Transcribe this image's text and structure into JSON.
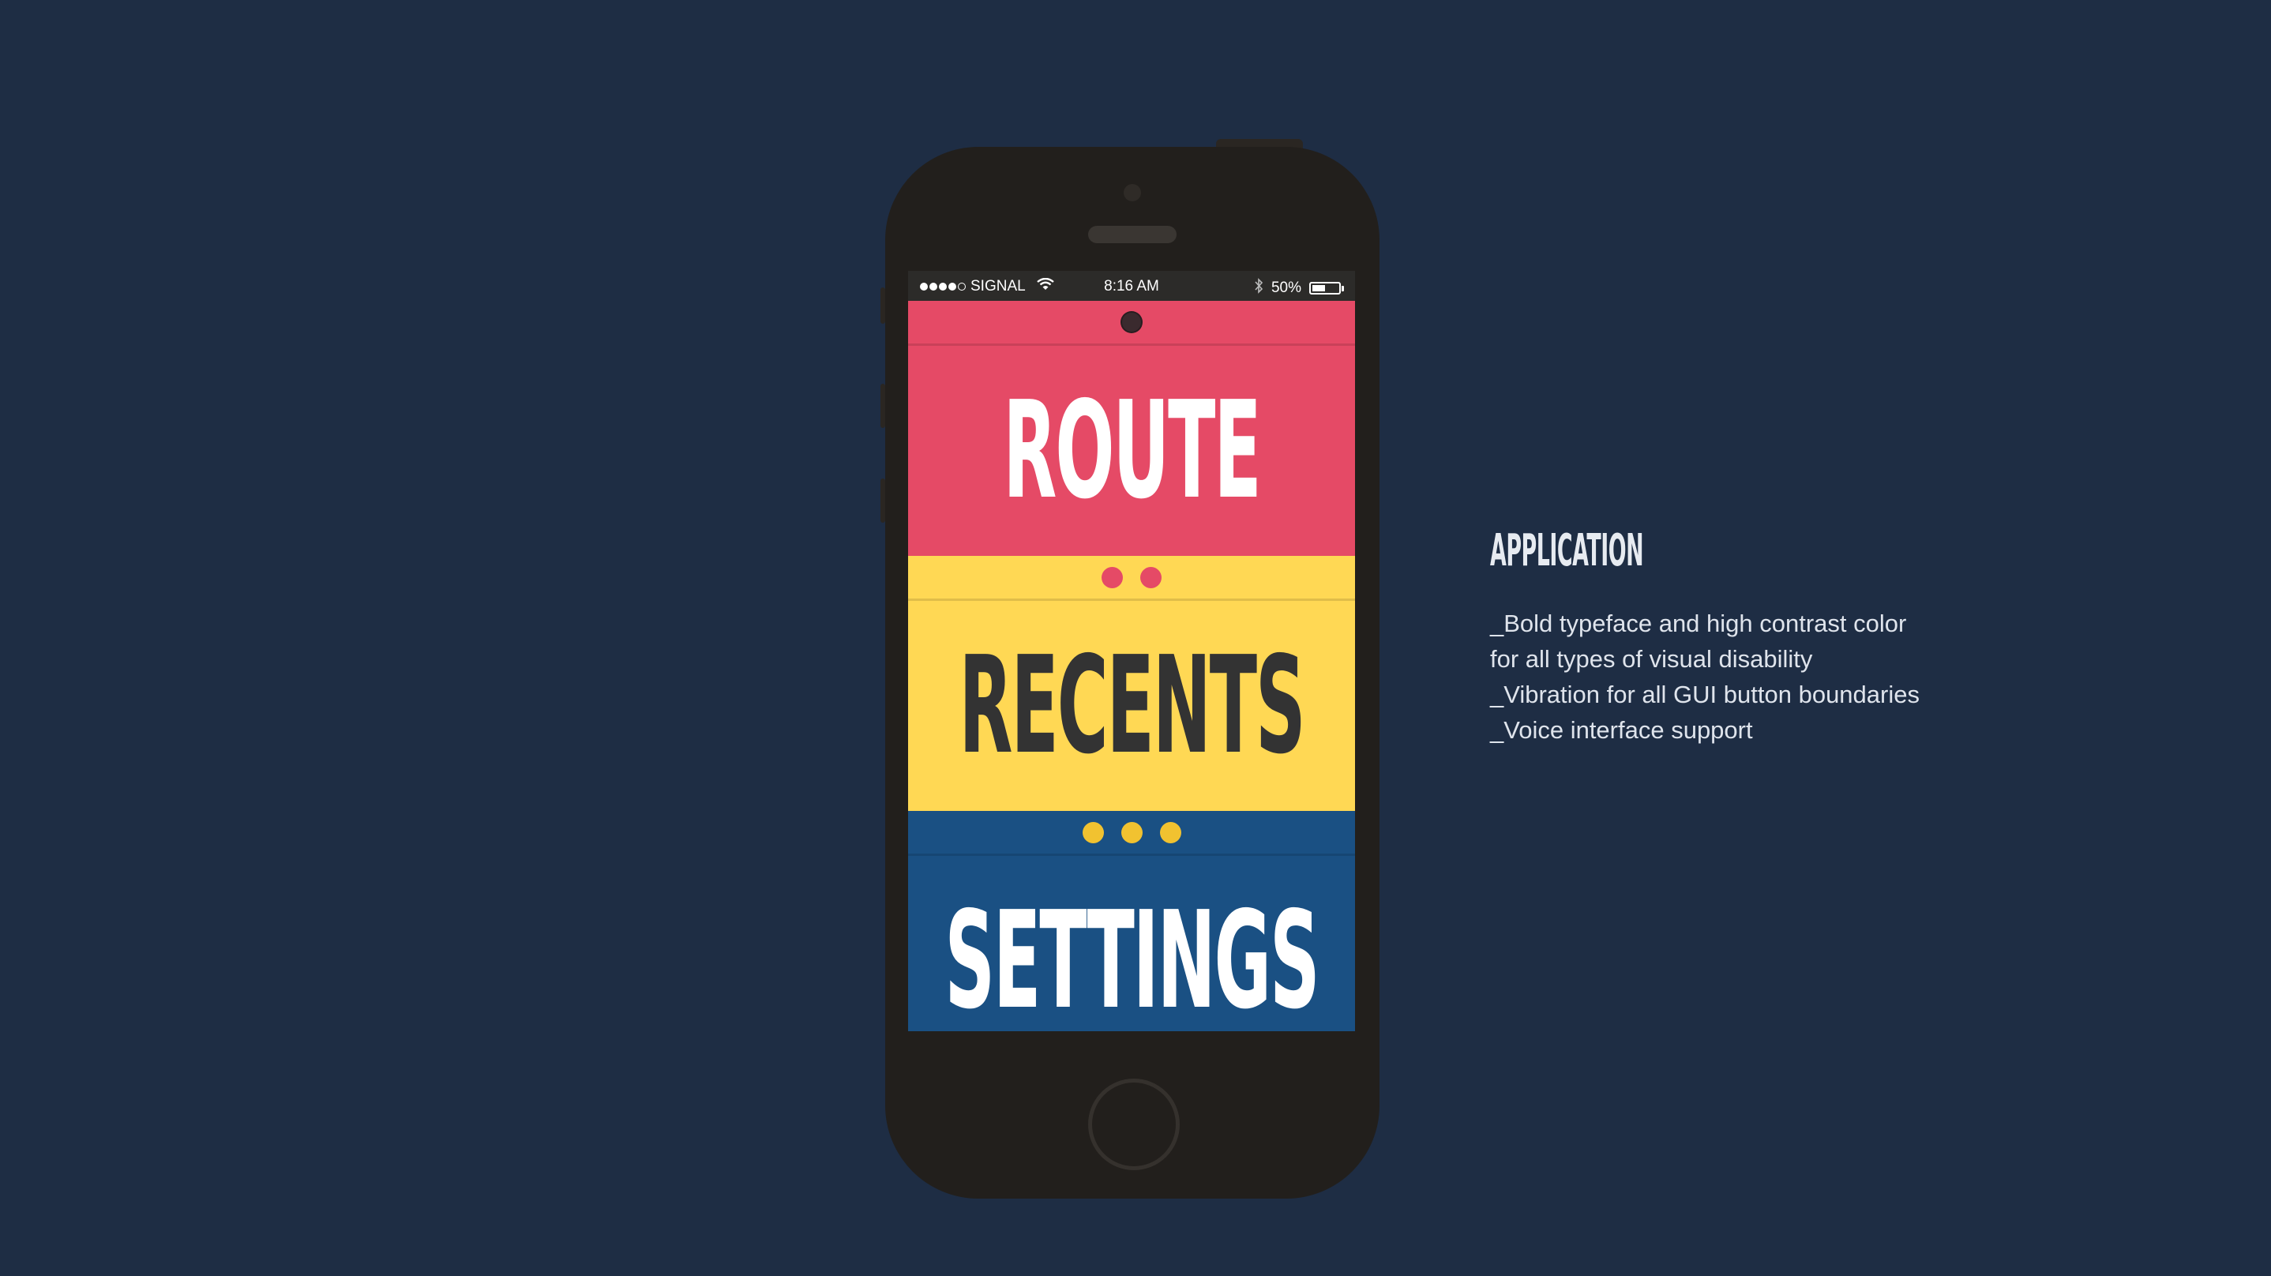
{
  "colors": {
    "background": "#1e2d44",
    "phone_body": "#221f1c",
    "route": "#e54a66",
    "recents": "#ffd854",
    "settings": "#1a5083",
    "recents_dots": "#e54a66",
    "settings_dots": "#f1c230",
    "route_dot": "#3a2a2e",
    "dark_text": "#333333",
    "light_text": "#ffffff"
  },
  "statusbar": {
    "carrier": "SIGNAL",
    "time": "8:16 AM",
    "battery_percent": "50%",
    "battery_level": 0.5,
    "signal_bars": 4,
    "signal_total": 5,
    "icons": [
      "wifi-icon",
      "bluetooth-icon",
      "battery-icon"
    ]
  },
  "menu": [
    {
      "label": "ROUTE",
      "dots": 1
    },
    {
      "label": "RECENTS",
      "dots": 2
    },
    {
      "label": "SETTINGS",
      "dots": 3
    }
  ],
  "panel": {
    "title": "APPLICATION",
    "lines": [
      "_Bold typeface and high contrast color",
      "for all types of visual disability",
      "_Vibration for all GUI button boundaries",
      "_Voice interface support"
    ]
  }
}
